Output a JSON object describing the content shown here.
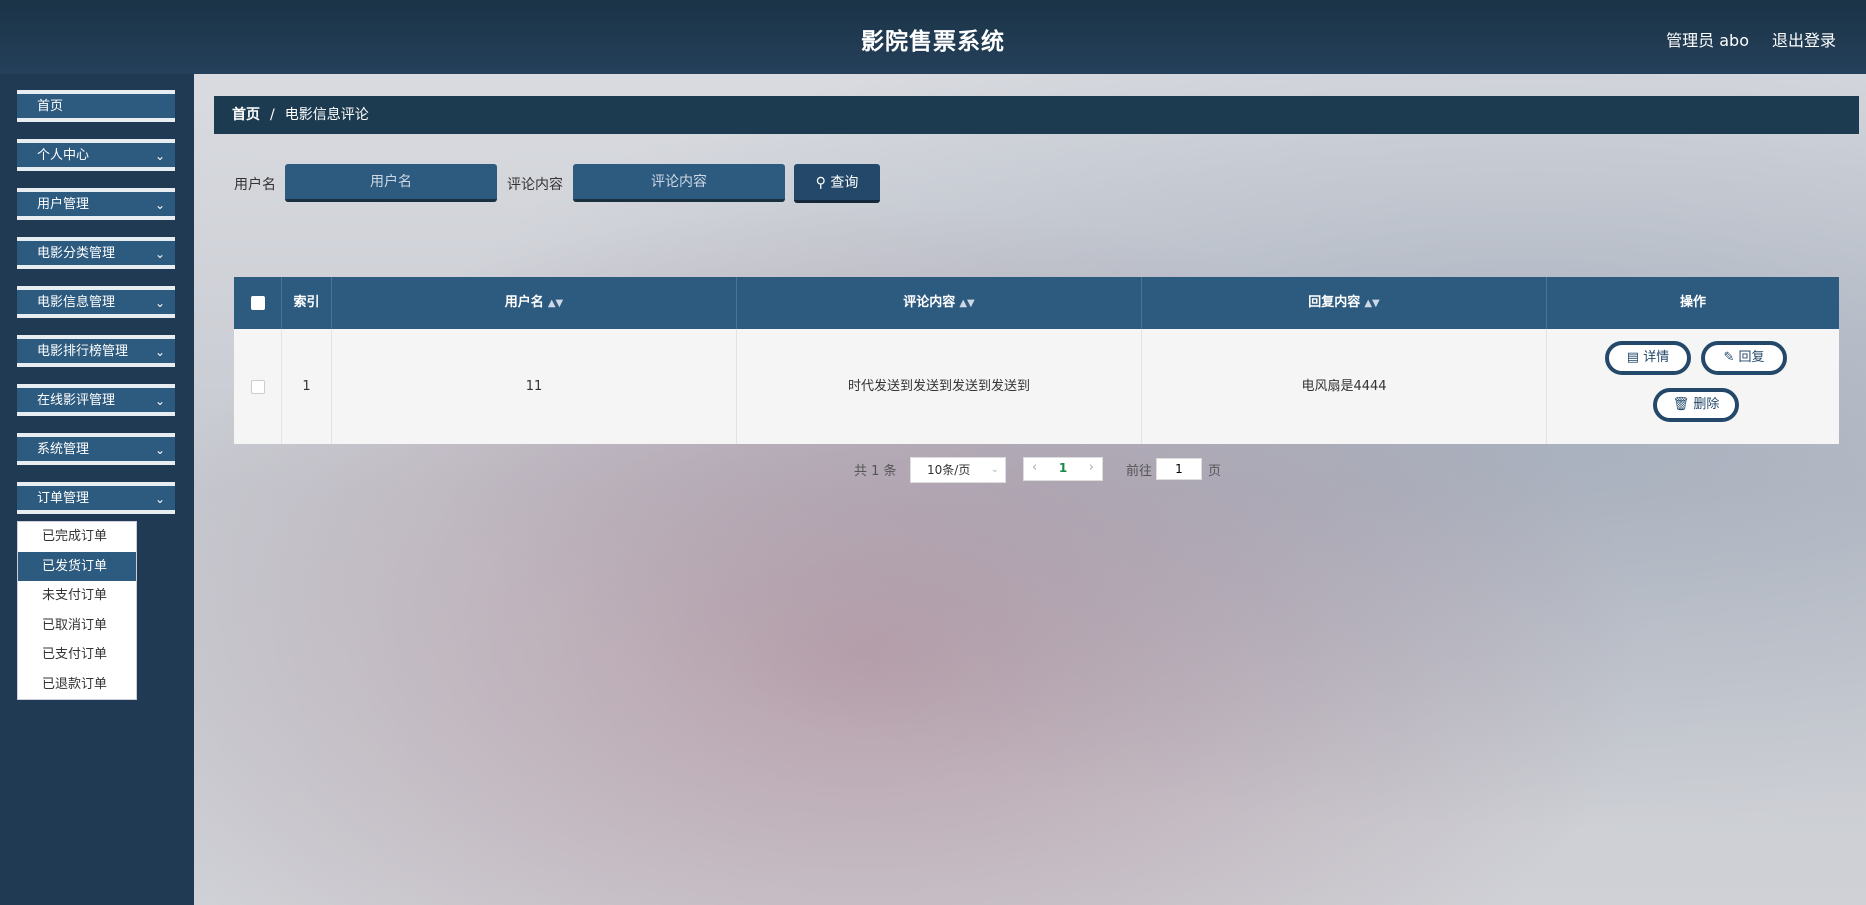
{
  "header": {
    "title": "影院售票系统",
    "admin_label": "管理员 abo",
    "logout": "退出登录"
  },
  "sidebar": {
    "items": [
      {
        "label": "首页",
        "has_chevron": false
      },
      {
        "label": "个人中心",
        "has_chevron": true
      },
      {
        "label": "用户管理",
        "has_chevron": true
      },
      {
        "label": "电影分类管理",
        "has_chevron": true
      },
      {
        "label": "电影信息管理",
        "has_chevron": true
      },
      {
        "label": "电影排行榜管理",
        "has_chevron": true
      },
      {
        "label": "在线影评管理",
        "has_chevron": true
      },
      {
        "label": "系统管理",
        "has_chevron": true
      },
      {
        "label": "订单管理",
        "has_chevron": true
      }
    ],
    "submenu": [
      "已完成订单",
      "已发货订单",
      "未支付订单",
      "已取消订单",
      "已支付订单",
      "已退款订单"
    ],
    "active_submenu": "已发货订单"
  },
  "breadcrumb": {
    "home": "首页",
    "separator": "/",
    "current": "电影信息评论"
  },
  "search": {
    "username_label": "用户名",
    "username_placeholder": "用户名",
    "content_label": "评论内容",
    "content_placeholder": "评论内容",
    "button": "查询"
  },
  "table": {
    "headers": [
      "索引",
      "用户名",
      "评论内容",
      "回复内容",
      "操作"
    ],
    "rows": [
      {
        "index": "1",
        "username": "11",
        "content": "时代发送到发送到发送到发送到",
        "reply": "电风扇是4444"
      }
    ],
    "actions": {
      "detail": "详情",
      "reply": "回复",
      "delete": "删除"
    }
  },
  "pagination": {
    "total": "共 1 条",
    "page_size": "10条/页",
    "current_page": "1",
    "goto_prefix": "前往",
    "goto_value": "1",
    "goto_suffix": "页"
  },
  "colors": {
    "header_bg": "#1b3347",
    "accent": "#2d5a7f",
    "sidebar_bg": "#1f3a52"
  }
}
